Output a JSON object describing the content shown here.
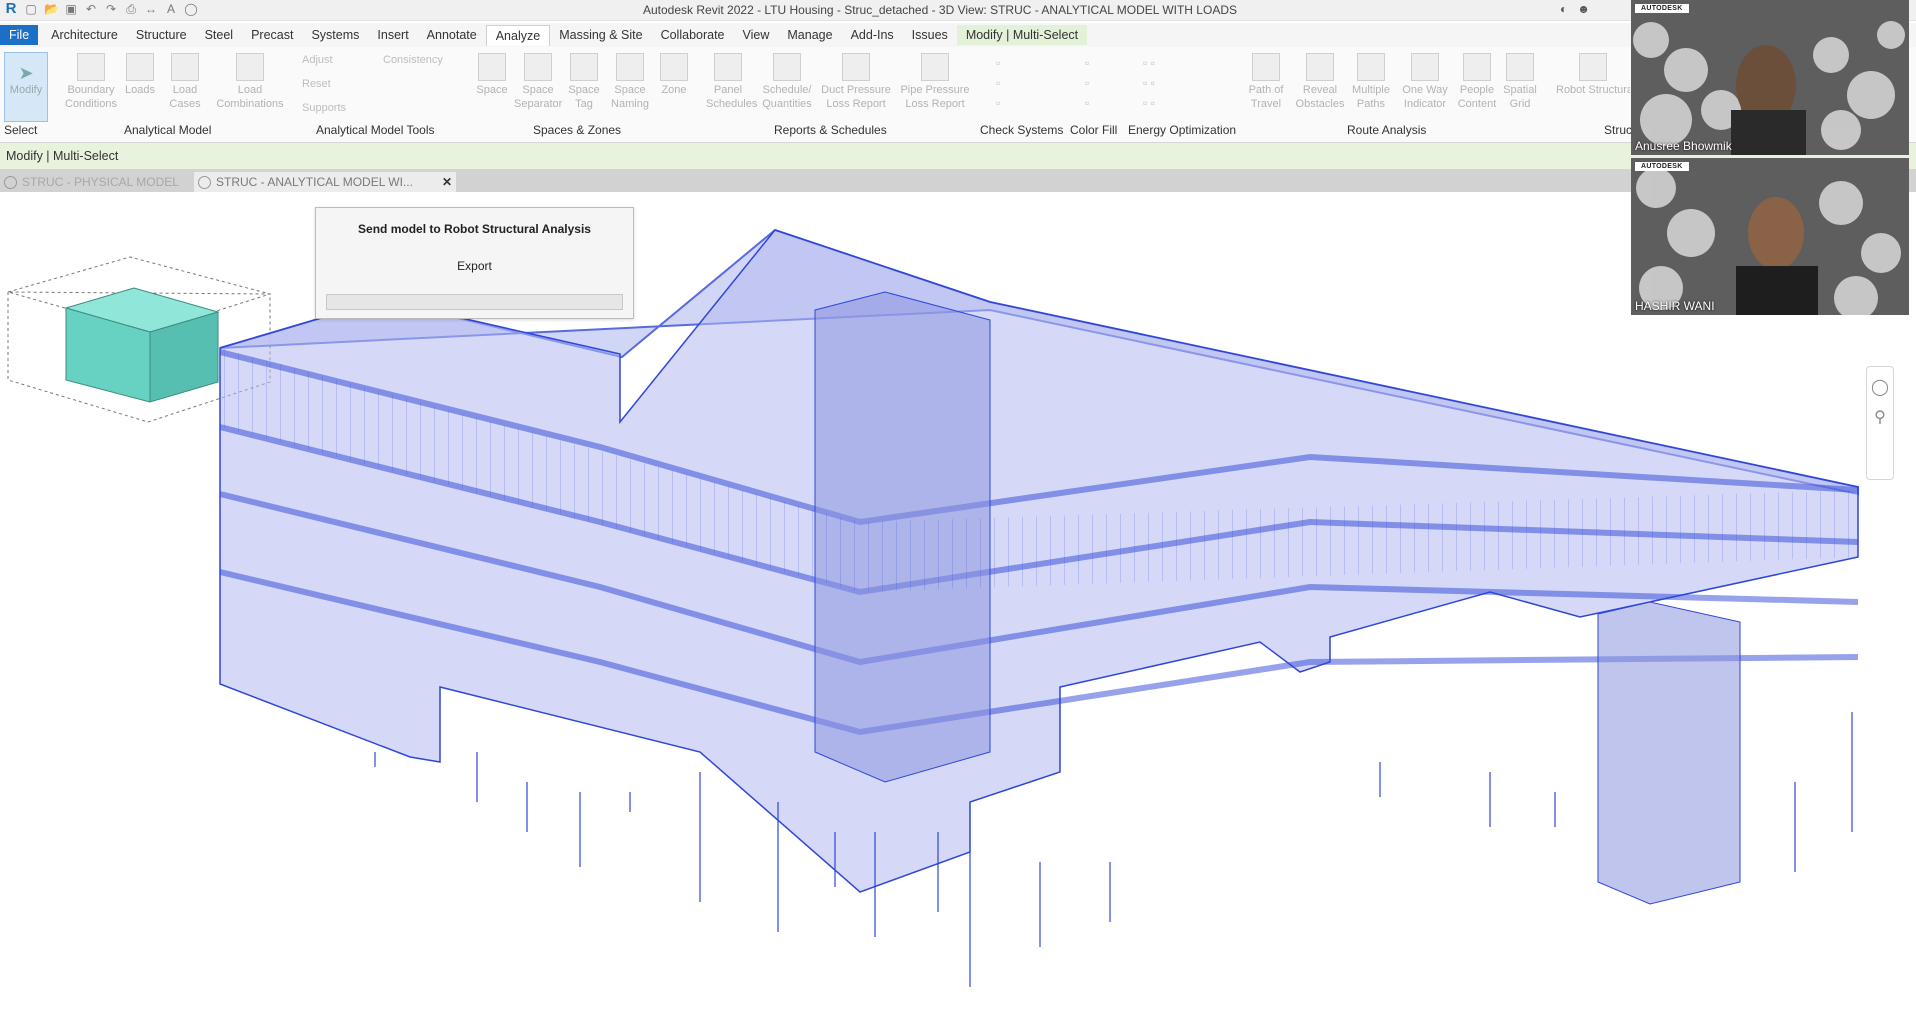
{
  "title_bar": {
    "title": "Autodesk Revit 2022 - LTU Housing - Struc_detached - 3D View: STRUC - ANALYTICAL MODEL WITH LOADS"
  },
  "ribbon_tabs": [
    "File",
    "Architecture",
    "Structure",
    "Steel",
    "Precast",
    "Systems",
    "Insert",
    "Annotate",
    "Analyze",
    "Massing & Site",
    "Collaborate",
    "View",
    "Manage",
    "Add-Ins",
    "Issues",
    "Modify | Multi-Select"
  ],
  "active_tab": "Analyze",
  "ribbon": {
    "modify_label": "Modify",
    "select_label": "Select",
    "tools": [
      {
        "label": "Boundary Conditions"
      },
      {
        "label": "Loads"
      },
      {
        "label": "Load Cases"
      },
      {
        "label": "Load Combinations"
      },
      {
        "label": "Space"
      },
      {
        "label": "Space Separator"
      },
      {
        "label": "Space Tag"
      },
      {
        "label": "Space Naming"
      },
      {
        "label": "Zone"
      },
      {
        "label": "Panel Schedules"
      },
      {
        "label": "Schedule/ Quantities"
      },
      {
        "label": "Duct Pressure Loss Report"
      },
      {
        "label": "Pipe Pressure Loss Report"
      },
      {
        "label": "Path of Travel"
      },
      {
        "label": "Reveal Obstacles"
      },
      {
        "label": "Multiple Paths"
      },
      {
        "label": "One Way Indicator"
      },
      {
        "label": "People Content"
      },
      {
        "label": "Spatial Grid"
      },
      {
        "label": "Robot Structural Ana"
      }
    ],
    "small_tools": [
      "Adjust",
      "Consistency",
      "Reset",
      "Supports"
    ],
    "panels": [
      "Analytical Model",
      "Analytical Model Tools",
      "Spaces & Zones",
      "Reports & Schedules",
      "Check Systems",
      "Color Fill",
      "Energy Optimization",
      "Route Analysis",
      "Struc"
    ]
  },
  "context_bar": {
    "label": "Modify | Multi-Select"
  },
  "view_tabs": [
    {
      "label": "STRUC - PHYSICAL MODEL",
      "active": false
    },
    {
      "label": "STRUC - ANALYTICAL MODEL WI...",
      "active": true
    }
  ],
  "dialog": {
    "title": "Send model to Robot Structural Analysis",
    "button": "Export",
    "progress": 0
  },
  "participants": [
    {
      "brand": "AUTODESK",
      "name": "Anusree Bhowmik"
    },
    {
      "brand": "AUTODESK",
      "name": "HASHIR WANI"
    }
  ],
  "colors": {
    "model_line": "#2f46d8",
    "model_fill": "#aeb6f0",
    "file_tab": "#1c6fc6",
    "context": "#e8f3dd",
    "viewcube": "#7fd8cc"
  },
  "icons": [
    "revit-logo",
    "open-icon",
    "save-icon",
    "undo-icon",
    "redo-icon",
    "print-icon",
    "measure-icon",
    "text-icon",
    "binoculars-icon",
    "user-icon",
    "close-icon",
    "steering-wheel-icon",
    "zoom-icon"
  ]
}
